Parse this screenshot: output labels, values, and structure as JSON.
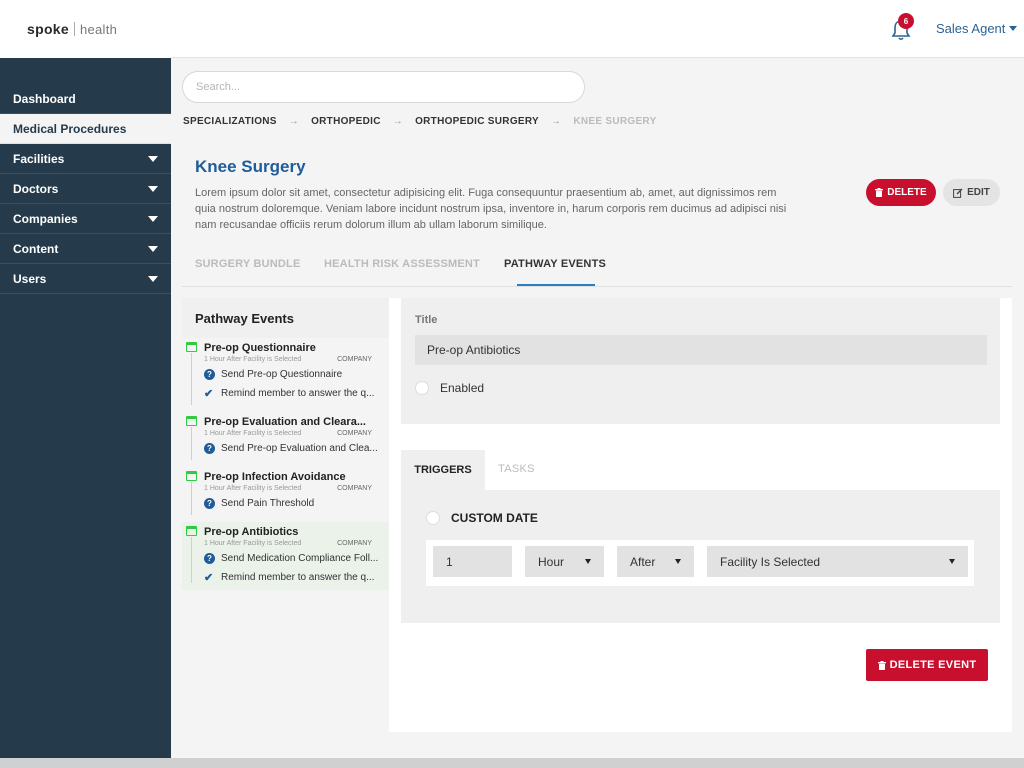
{
  "logo": {
    "brand": "spoke",
    "sub": "health"
  },
  "sidebar": {
    "items": [
      {
        "label": "Dashboard"
      },
      {
        "label": "Medical Procedures"
      },
      {
        "label": "Facilities"
      },
      {
        "label": "Doctors"
      },
      {
        "label": "Companies"
      },
      {
        "label": "Content"
      },
      {
        "label": "Users"
      }
    ]
  },
  "header": {
    "notification_count": "6",
    "user_label": "Sales Agent"
  },
  "search": {
    "placeholder": "Search..."
  },
  "breadcrumb": [
    "SPECIALIZATIONS",
    "ORTHOPEDIC",
    "ORTHOPEDIC SURGERY",
    "KNEE SURGERY"
  ],
  "procedure": {
    "title": "Knee Surgery",
    "description": "Lorem ipsum dolor sit amet, consectetur adipisicing elit. Fuga consequuntur praesentium ab, amet, aut dignissimos rem quia nostrum doloremque. Veniam labore incidunt nostrum ipsa, inventore in, harum corporis rem ducimus ad adipisci nisi nam recusandae officiis rerum dolorum illum ab ullam laborum similique.",
    "delete_label": "DELETE",
    "edit_label": "EDIT"
  },
  "tabs": [
    "SURGERY BUNDLE",
    "HEALTH RISK ASSESSMENT",
    "PATHWAY EVENTS"
  ],
  "events": {
    "heading": "Pathway Events",
    "items": [
      {
        "title": "Pre-op Questionnaire",
        "timing": "1 Hour After Facility is Selected",
        "audience": "COMPANY",
        "subs": [
          {
            "type": "question",
            "text": "Send Pre-op Questionnaire"
          },
          {
            "type": "check",
            "text": "Remind member to answer the q..."
          }
        ]
      },
      {
        "title": "Pre-op Evaluation and Cleara...",
        "timing": "1 Hour After Facility is Selected",
        "audience": "COMPANY",
        "subs": [
          {
            "type": "question",
            "text": "Send Pre-op Evaluation and Clea..."
          }
        ]
      },
      {
        "title": "Pre-op Infection Avoidance",
        "timing": "1 Hour After Facility is Selected",
        "audience": "COMPANY",
        "subs": [
          {
            "type": "question",
            "text": "Send Pain Threshold"
          }
        ]
      },
      {
        "title": "Pre-op Antibiotics",
        "timing": "1 Hour After Facility is Selected",
        "audience": "COMPANY",
        "subs": [
          {
            "type": "question",
            "text": "Send Medication Compliance Foll..."
          },
          {
            "type": "check",
            "text": "Remind member to answer the q..."
          }
        ]
      }
    ]
  },
  "detail": {
    "title_label": "Title",
    "title_value": "Pre-op Antibiotics",
    "enabled_label": "Enabled",
    "triggers_tab": "TRIGGERS",
    "tasks_tab": "TASKS",
    "custom_date_label": "CUSTOM DATE",
    "amount": "1",
    "unit": "Hour",
    "relation": "After",
    "event": "Facility Is Selected",
    "delete_event_label": "DELETE EVENT"
  },
  "colors": {
    "sidebar": "#253b4b",
    "accent": "#1f5c99",
    "danger": "#c8102e",
    "calendar": "#2ecc40"
  }
}
